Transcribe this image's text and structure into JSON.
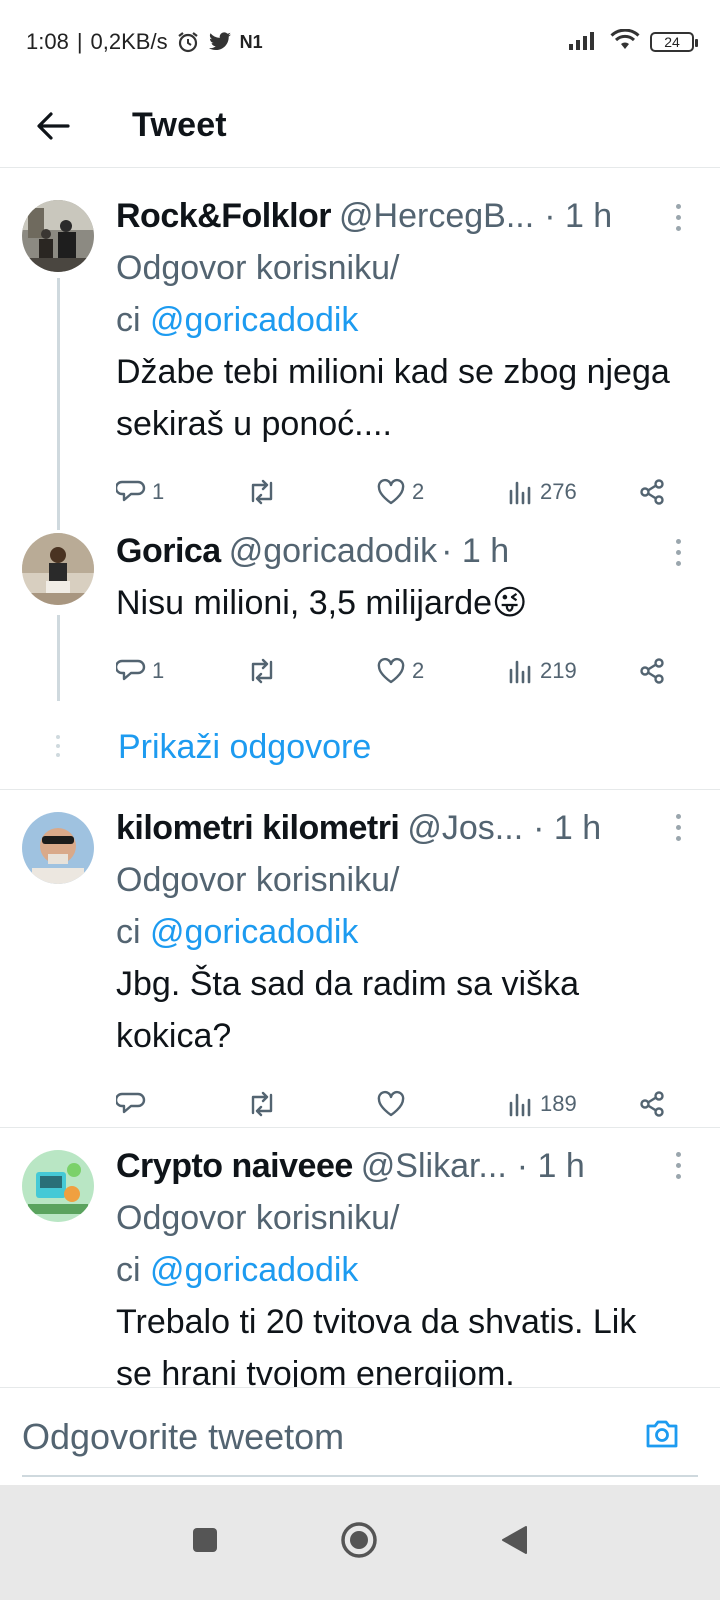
{
  "status_bar": {
    "time": "1:08",
    "net_speed": "0,2KB/s",
    "carrier_icon_text": "N1",
    "battery": "24"
  },
  "header": {
    "title": "Tweet"
  },
  "tweets": [
    {
      "name": "Rock&Folklor",
      "handle": "@HercegB...",
      "time": "· 1 h",
      "reply_prefix": "Odgovor korisniku/",
      "reply_prefix2": "ci",
      "mention": "@goricadodik",
      "text": "Džabe tebi milioni kad se zbog njega sekiraš u ponoć....",
      "replies": "1",
      "retweets": "",
      "likes": "2",
      "views": "276"
    },
    {
      "name": "Gorica",
      "handle": "@goricadodik",
      "time": "· 1 h",
      "text": "Nisu milioni, 3,5 milijarde😜",
      "replies": "1",
      "retweets": "",
      "likes": "2",
      "views": "219"
    },
    {
      "name": "kilometri kilometri",
      "handle": "@Jos...",
      "time": "· 1 h",
      "reply_prefix": "Odgovor korisniku/",
      "reply_prefix2": "ci",
      "mention": "@goricadodik",
      "text": "Jbg. Šta sad da radim sa viška kokica?",
      "replies": "",
      "retweets": "",
      "likes": "",
      "views": "189"
    },
    {
      "name": "Crypto naiveee",
      "handle": "@Slikar...",
      "time": "· 1 h",
      "reply_prefix": "Odgovor korisniku/",
      "reply_prefix2": "ci",
      "mention": "@goricadodik",
      "text": "Trebalo ti 20 tvitova da shvatis. Lik se hrani tvojom energijom."
    }
  ],
  "show_replies": "Prikaži odgovore",
  "reply_bar": {
    "placeholder": "Odgovorite tweetom"
  },
  "colors": {
    "accent": "#1d9bf0",
    "secondary_text": "#536471",
    "primary_text": "#0f1419"
  }
}
